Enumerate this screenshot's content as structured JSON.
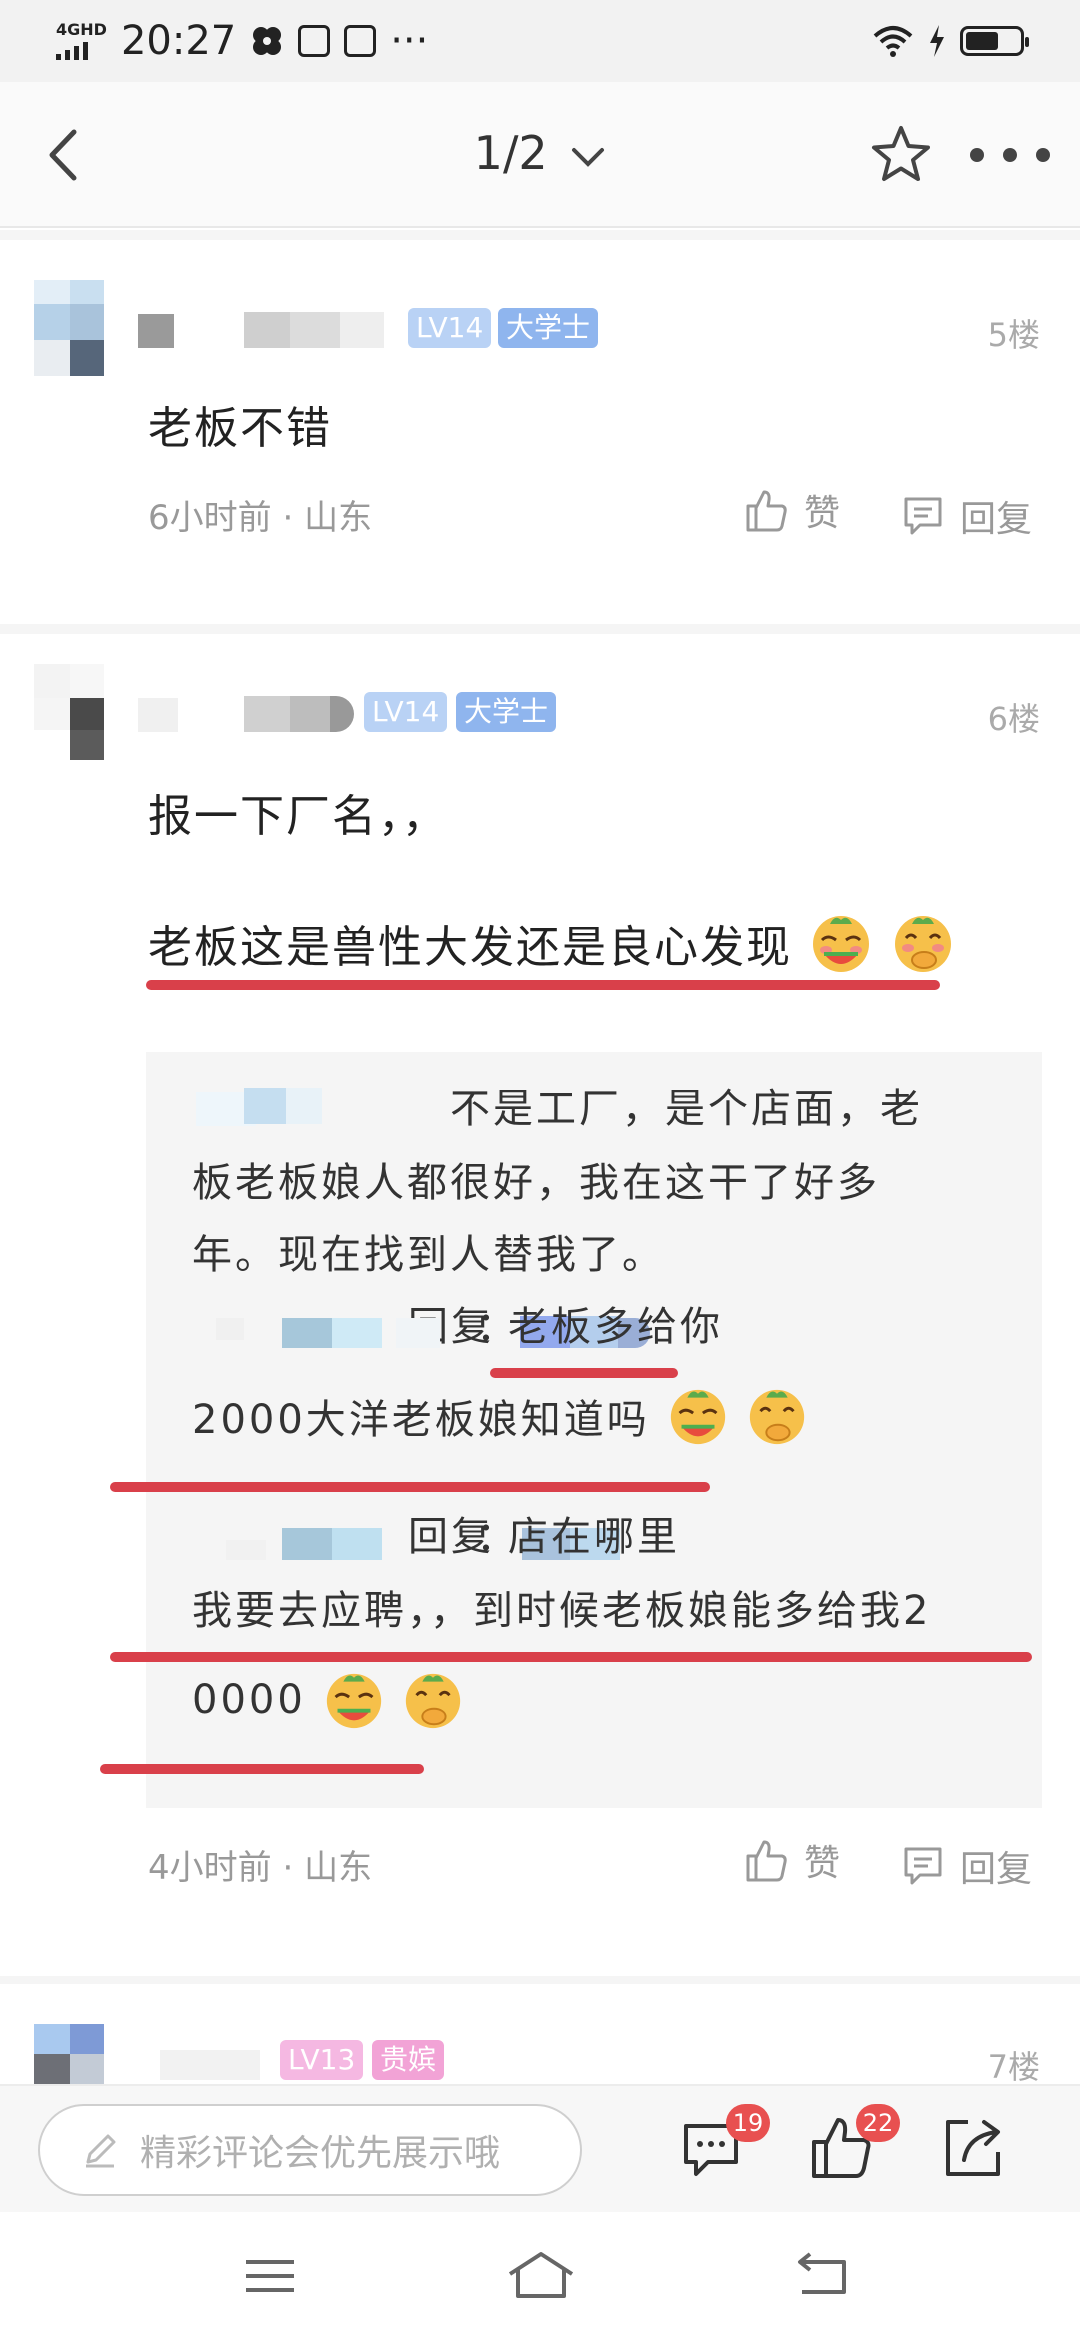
{
  "status_bar": {
    "network": "4GHD",
    "time": "20:27",
    "extra": "···"
  },
  "header": {
    "page_indicator": "1/2"
  },
  "comments": [
    {
      "floor": "5楼",
      "level": "LV14",
      "title": "大学士",
      "text": "老板不错",
      "time": "6小时前",
      "location": "山东",
      "like_label": "赞",
      "reply_label": "回复"
    },
    {
      "floor": "6楼",
      "level": "LV14",
      "title": "大学士",
      "text_line1": "报一下厂名，，",
      "text_line2": "老板这是兽性大发还是良心发现",
      "time": "4小时前",
      "location": "山东",
      "like_label": "赞",
      "reply_label": "回复",
      "replies": {
        "r1_line1": "不是工厂，是个店面，老",
        "r1_line2": "板老板娘人都很好，我在这干了好多",
        "r1_line3": "年。现在找到人替我了。",
        "r2_reply_word": "回复",
        "r2_colon": "：",
        "r2_text1": "老板多给你",
        "r2_text2": "2000大洋老板娘知道吗",
        "r3_reply_word": "回复",
        "r3_colon": "：",
        "r3_text1": "店在哪里",
        "r3_text2": "我要去应聘，，到时候老板娘能多给我2",
        "r3_text3": "0000"
      }
    },
    {
      "floor": "7楼",
      "level": "LV13",
      "title": "贵嫔"
    }
  ],
  "bottom_bar": {
    "input_placeholder": "精彩评论会优先展示哦",
    "comment_count": "19",
    "like_count": "22"
  },
  "colors": {
    "accent_red": "#d9404a",
    "badge_blue": "#8fb5ee",
    "badge_pink": "#f2a3d6",
    "count_red": "#e85050"
  },
  "icons": [
    "back-arrow-icon",
    "chevron-down-icon",
    "star-icon",
    "more-dots-icon",
    "thumb-up-icon",
    "reply-bubble-icon",
    "pencil-icon",
    "comment-icon",
    "share-icon",
    "menu-icon",
    "home-icon",
    "return-icon"
  ]
}
